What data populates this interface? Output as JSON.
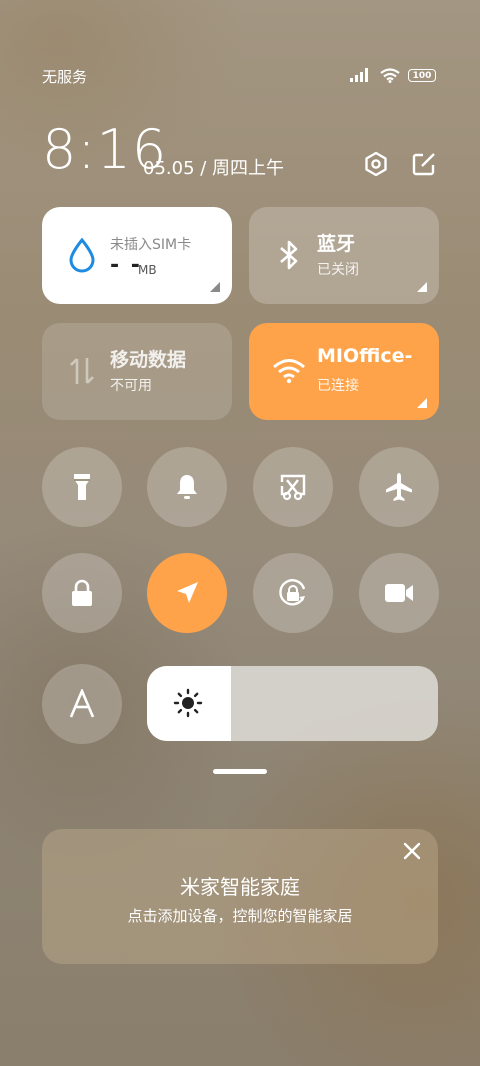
{
  "status_bar": {
    "carrier": "无服务",
    "battery": "100",
    "icons": [
      "signal-icon",
      "wifi-icon",
      "battery-icon"
    ]
  },
  "header": {
    "time": "8:16",
    "date": "05.05 / 周四上午",
    "icons": [
      "settings-icon",
      "edit-icon"
    ]
  },
  "tiles": {
    "data": {
      "title": "未插入SIM卡",
      "value": "- -",
      "unit": "MB",
      "icon": "water-drop-icon",
      "accent": "#1e8ae0"
    },
    "bluetooth": {
      "title": "蓝牙",
      "sub": "已关闭",
      "icon": "bluetooth-icon"
    },
    "mobile_data": {
      "title": "移动数据",
      "sub": "不可用",
      "icon": "mobile-data-icon"
    },
    "wifi": {
      "title": "MIOffice-",
      "sub": "已连接",
      "icon": "wifi-icon",
      "accent": "#ffa34a"
    }
  },
  "toggles_row1": [
    "flashlight-icon",
    "bell-icon",
    "screenshot-icon",
    "airplane-icon"
  ],
  "toggles_row2": [
    "lock-icon",
    "location-icon",
    "rotation-lock-icon",
    "video-icon"
  ],
  "auto_brightness_icon": "font-a-icon",
  "brightness": {
    "level": 0.29,
    "icon": "sun-icon"
  },
  "smart_home": {
    "title": "米家智能家庭",
    "subtitle": "点击添加设备，控制您的智能家居",
    "close_icon": "close-icon"
  }
}
